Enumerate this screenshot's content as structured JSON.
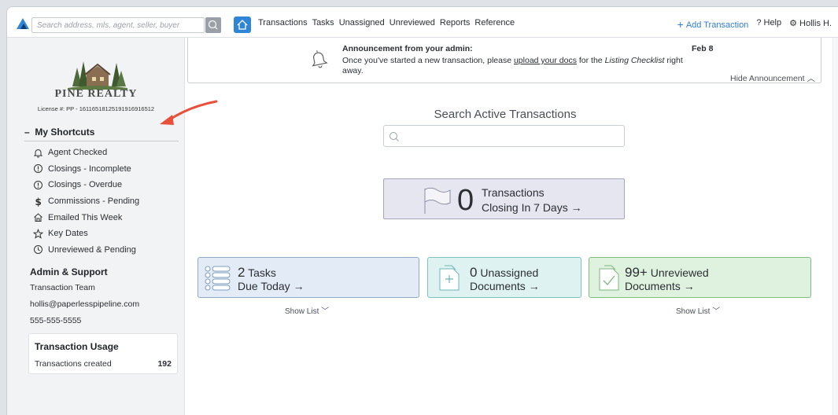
{
  "topbar": {
    "search_placeholder": "Search address, mls, agent, seller, buyer",
    "nav": [
      "Transactions",
      "Tasks",
      "Unassigned",
      "Unreviewed",
      "Reports",
      "Reference"
    ],
    "add_transaction": "Add Transaction",
    "help": "Help",
    "user": "Hollis H."
  },
  "sidebar": {
    "brand": "PINE REALTY",
    "license": "License #: PP - 16116518125191916916512",
    "shortcuts_title": "My Shortcuts",
    "shortcuts_toggle": "–",
    "shortcuts": [
      {
        "label": "Agent Checked",
        "icon": "bell-icon"
      },
      {
        "label": "Closings - Incomplete",
        "icon": "alert-circle-icon"
      },
      {
        "label": "Closings - Overdue",
        "icon": "alert-circle-icon"
      },
      {
        "label": "Commissions - Pending",
        "icon": "dollar-icon"
      },
      {
        "label": "Emailed This Week",
        "icon": "home-icon"
      },
      {
        "label": "Key Dates",
        "icon": "star-icon"
      },
      {
        "label": "Unreviewed & Pending",
        "icon": "clock-icon"
      }
    ],
    "admin_title": "Admin & Support",
    "admin_team": "Transaction Team",
    "admin_email": "hollis@paperlesspipeline.com",
    "admin_phone": "555-555-5555",
    "usage_title": "Transaction Usage",
    "usage_label": "Transactions created",
    "usage_value": "192"
  },
  "announcement": {
    "title": "Announcement from your admin:",
    "date": "Feb 8",
    "body_pre": "Once you've started a new transaction, please ",
    "body_link": "upload your docs",
    "body_mid": " for the ",
    "body_italic": "Listing Checklist",
    "body_post": " right away.",
    "hide": "Hide Announcement"
  },
  "main": {
    "search_title": "Search Active Transactions",
    "closing_count": "0",
    "closing_line1": "Transactions",
    "closing_line2": "Closing In 7 Days →",
    "tasks_count": "2",
    "tasks_line1": "Tasks",
    "tasks_line2": "Due Today →",
    "unassigned_count": "0",
    "unassigned_line1": "Unassigned",
    "unassigned_line2": "Documents →",
    "unreviewed_count": "99+",
    "unreviewed_line1": "Unreviewed",
    "unreviewed_line2": "Documents →",
    "show_list": "Show List"
  },
  "colors": {
    "accent": "#2f86d6",
    "arrow": "#e8503a"
  }
}
